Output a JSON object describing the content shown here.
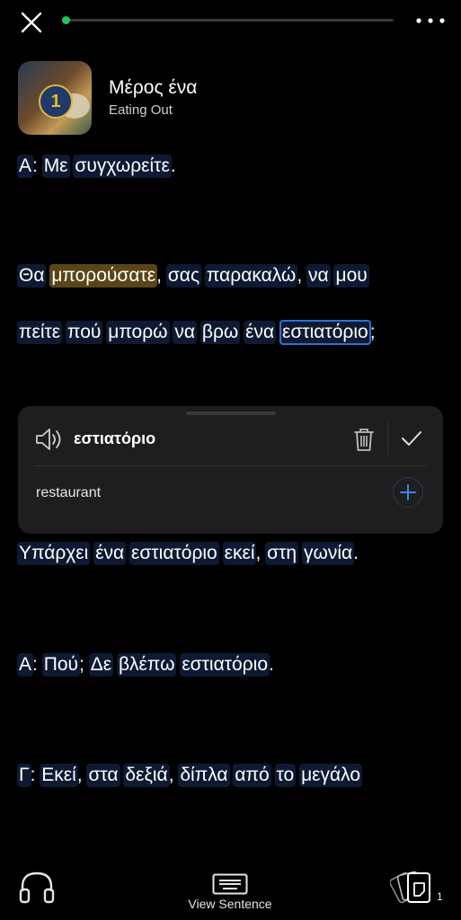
{
  "header": {
    "lesson_number": "1",
    "title": "Μέρος ένα",
    "subtitle": "Eating Out"
  },
  "progress": {
    "fraction": 0.01,
    "color": "#22c55e"
  },
  "lines": [
    {
      "segments": [
        {
          "t": "Α",
          "type": "word"
        },
        {
          "t": ": ",
          "type": "punct"
        },
        {
          "t": "Με",
          "type": "word"
        },
        {
          "t": " ",
          "type": "punct"
        },
        {
          "t": "συγχωρείτε",
          "type": "word"
        },
        {
          "t": ".",
          "type": "punct"
        }
      ]
    },
    {
      "segments": [
        {
          "t": "Θα",
          "type": "word"
        },
        {
          "t": " ",
          "type": "punct"
        },
        {
          "t": "μπορούσατε",
          "type": "known"
        },
        {
          "t": ", ",
          "type": "punct"
        },
        {
          "t": "σας",
          "type": "word"
        },
        {
          "t": " ",
          "type": "punct"
        },
        {
          "t": "παρακαλώ",
          "type": "word"
        },
        {
          "t": ", ",
          "type": "punct"
        },
        {
          "t": "να",
          "type": "word"
        },
        {
          "t": " ",
          "type": "punct"
        },
        {
          "t": "μου",
          "type": "word"
        }
      ]
    },
    {
      "segments": [
        {
          "t": "πείτε",
          "type": "word"
        },
        {
          "t": " ",
          "type": "punct"
        },
        {
          "t": "πού",
          "type": "word"
        },
        {
          "t": " ",
          "type": "punct"
        },
        {
          "t": "μπορώ",
          "type": "word"
        },
        {
          "t": " ",
          "type": "punct"
        },
        {
          "t": "να",
          "type": "word"
        },
        {
          "t": " ",
          "type": "punct"
        },
        {
          "t": "βρω",
          "type": "word"
        },
        {
          "t": " ",
          "type": "punct"
        },
        {
          "t": "ένα",
          "type": "word"
        },
        {
          "t": " ",
          "type": "punct"
        },
        {
          "t": "εστιατόριο",
          "type": "selected"
        },
        {
          "t": ";",
          "type": "punct"
        }
      ]
    },
    {
      "segments": [
        {
          "t": "Υπάρχει",
          "type": "word"
        },
        {
          "t": " ",
          "type": "punct"
        },
        {
          "t": "ένα",
          "type": "word"
        },
        {
          "t": " ",
          "type": "punct"
        },
        {
          "t": "εστιατόριο",
          "type": "word"
        },
        {
          "t": " ",
          "type": "punct"
        },
        {
          "t": "εκεί",
          "type": "word"
        },
        {
          "t": ", ",
          "type": "punct"
        },
        {
          "t": "στη",
          "type": "word"
        },
        {
          "t": " ",
          "type": "punct"
        },
        {
          "t": "γωνία",
          "type": "word"
        },
        {
          "t": ".",
          "type": "punct"
        }
      ]
    },
    {
      "segments": [
        {
          "t": "Α",
          "type": "word"
        },
        {
          "t": ": ",
          "type": "punct"
        },
        {
          "t": "Πού",
          "type": "word"
        },
        {
          "t": "; ",
          "type": "punct"
        },
        {
          "t": "Δε",
          "type": "word"
        },
        {
          "t": " ",
          "type": "punct"
        },
        {
          "t": "βλέπω",
          "type": "word"
        },
        {
          "t": " ",
          "type": "punct"
        },
        {
          "t": "εστιατόριο",
          "type": "word"
        },
        {
          "t": ".",
          "type": "punct"
        }
      ]
    },
    {
      "segments": [
        {
          "t": "Γ",
          "type": "word"
        },
        {
          "t": ": ",
          "type": "punct"
        },
        {
          "t": "Εκεί",
          "type": "word"
        },
        {
          "t": ", ",
          "type": "punct"
        },
        {
          "t": "στα",
          "type": "word"
        },
        {
          "t": " ",
          "type": "punct"
        },
        {
          "t": "δεξιά",
          "type": "word"
        },
        {
          "t": ", ",
          "type": "punct"
        },
        {
          "t": "δίπλα",
          "type": "word"
        },
        {
          "t": " ",
          "type": "punct"
        },
        {
          "t": "από",
          "type": "word"
        },
        {
          "t": " ",
          "type": "punct"
        },
        {
          "t": "το",
          "type": "word"
        },
        {
          "t": " ",
          "type": "punct"
        },
        {
          "t": "μεγάλο",
          "type": "word"
        }
      ]
    }
  ],
  "popup": {
    "word": "εστιατόριο",
    "translation": "restaurant"
  },
  "bottom": {
    "view_sentence_label": "View Sentence",
    "card_count": "1"
  },
  "icons": {
    "close": "close-icon",
    "more": "more-dots-icon",
    "speaker": "speaker-icon",
    "trash": "trash-icon",
    "check": "check-icon",
    "add": "plus-icon",
    "headphones": "headphones-icon",
    "view_sentence": "keyboard-icon",
    "cards": "flashcards-icon"
  },
  "colors": {
    "word_bg": "#0e1a33",
    "known_bg": "#5a4518",
    "selected_border": "#2f6fd8",
    "accent": "#22c55e",
    "plus_blue": "#3b82f6"
  }
}
